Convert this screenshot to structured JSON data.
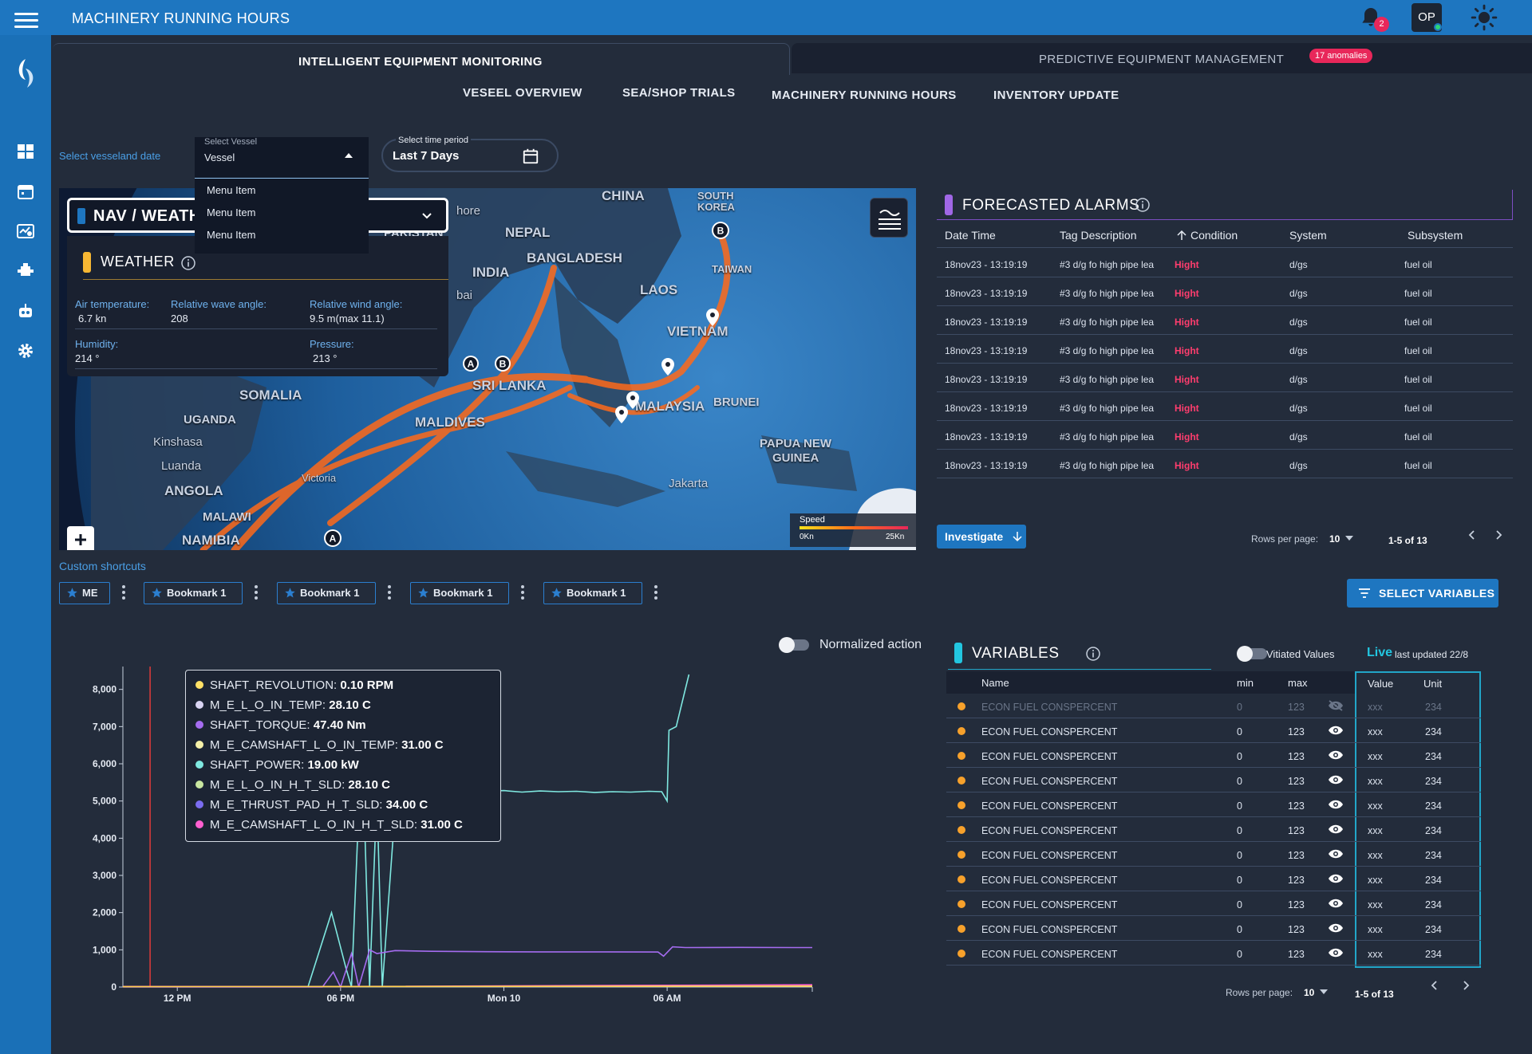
{
  "app": {
    "title": "MACHINERY RUNNING HOURS",
    "notification_count": "2",
    "user_initials": "OP"
  },
  "sidebar": {
    "items": [
      "logo-icon",
      "dashboard-icon",
      "calendar-icon",
      "analytics-icon",
      "engine-icon",
      "robot-icon",
      "settings-icon"
    ]
  },
  "tabs": {
    "active": "INTELLIGENT EQUIPMENT MONITORING",
    "other": "PREDICTIVE EQUIPMENT MANAGEMENT",
    "anomalies": "17 anomalies"
  },
  "subnav": [
    "VESEEL OVERVIEW",
    "SEA/SHOP TRIALS",
    "MACHINERY RUNNING HOURS",
    "INVENTORY UPDATE"
  ],
  "filters": {
    "section_label": "Select vesseland date",
    "vessel_label": "Select Vessel",
    "vessel_value": "Vessel",
    "menu_items": [
      "Menu Item",
      "Menu Item",
      "Menu Item"
    ],
    "time_label": "Select time period",
    "time_value": "Last 7 Days"
  },
  "map": {
    "layer_select": "NAV / WEATHER",
    "labels": {
      "china": "CHINA",
      "south_korea_1": "SOUTH",
      "south_korea_2": "KOREA",
      "nepal": "NEPAL",
      "pakistan": "PAKISTAN",
      "india": "INDIA",
      "bangladesh": "BANGLADESH",
      "taiwan": "TAIWAN",
      "laos": "LAOS",
      "vietnam": "VIETNAM",
      "sri_lanka": "SRI LANKA",
      "malaysia": "MALAYSIA",
      "brunei": "BRUNEI",
      "somalia": "SOMALIA",
      "uganda": "UGANDA",
      "maldives": "MALDIVES",
      "kinshasa": "Kinshasa",
      "luanda": "Luanda",
      "angola": "ANGOLA",
      "malawi": "MALAWI",
      "namibia": "NAMIBIA",
      "victoria": "Victoria",
      "jakarta": "Jakarta",
      "png_1": "PAPUA NEW",
      "png_2": "GUINEA",
      "hore": "hore",
      "bai": "bai"
    },
    "markers": {
      "a": "A",
      "b": "B"
    },
    "speed": {
      "title": "Speed",
      "min": "0Kn",
      "max": "25Kn"
    }
  },
  "weather": {
    "title": "WEATHER",
    "fields": [
      {
        "label": "Air temperature:",
        "value": "6.7 kn"
      },
      {
        "label": "Relative wave angle:",
        "value": "208"
      },
      {
        "label": "Relative wind angle:",
        "value": "9.5 m(max 11.1)"
      },
      {
        "label": "Humidity:",
        "value": "214 °"
      },
      {
        "label": "Pressure:",
        "value": "213 °"
      }
    ]
  },
  "alarms": {
    "title": "FORECASTED ALARMS",
    "columns": [
      "Date Time",
      "Tag Description",
      "Condition",
      "System",
      "Subsystem"
    ],
    "rows": [
      {
        "date": "18nov23 - 13:19:19",
        "tag": "#3 d/g fo high pipe lea",
        "condition": "Hight",
        "system": "d/gs",
        "subsystem": "fuel oil"
      },
      {
        "date": "18nov23 - 13:19:19",
        "tag": "#3 d/g fo high pipe lea",
        "condition": "Hight",
        "system": "d/gs",
        "subsystem": "fuel oil"
      },
      {
        "date": "18nov23 - 13:19:19",
        "tag": "#3 d/g fo high pipe lea",
        "condition": "Hight",
        "system": "d/gs",
        "subsystem": "fuel oil"
      },
      {
        "date": "18nov23 - 13:19:19",
        "tag": "#3 d/g fo high pipe lea",
        "condition": "Hight",
        "system": "d/gs",
        "subsystem": "fuel oil"
      },
      {
        "date": "18nov23 - 13:19:19",
        "tag": "#3 d/g fo high pipe lea",
        "condition": "Hight",
        "system": "d/gs",
        "subsystem": "fuel oil"
      },
      {
        "date": "18nov23 - 13:19:19",
        "tag": "#3 d/g fo high pipe lea",
        "condition": "Hight",
        "system": "d/gs",
        "subsystem": "fuel oil"
      },
      {
        "date": "18nov23 - 13:19:19",
        "tag": "#3 d/g fo high pipe lea",
        "condition": "Hight",
        "system": "d/gs",
        "subsystem": "fuel oil"
      },
      {
        "date": "18nov23 - 13:19:19",
        "tag": "#3 d/g fo high pipe lea",
        "condition": "Hight",
        "system": "d/gs",
        "subsystem": "fuel oil"
      }
    ],
    "investigate_label": "Investigate",
    "rows_per_page_label": "Rows per page:",
    "rows_per_page": "10",
    "range": "1-5 of 13"
  },
  "shortcuts": {
    "label": "Custom shortcuts",
    "items": [
      "ME",
      "Bookmark 1",
      "Bookmark 1",
      "Bookmark 1",
      "Bookmark 1"
    ],
    "select_variables_label": "SELECT VARIABLES"
  },
  "chart_controls": {
    "normalized_label": "Normalized action"
  },
  "chart_data": {
    "type": "line",
    "title": "",
    "xlabel": "",
    "ylabel": "",
    "ylim": [
      0,
      8400
    ],
    "yticks": [
      0,
      1000,
      2000,
      3000,
      4000,
      5000,
      6000,
      7000,
      8000
    ],
    "ytick_labels": [
      "0",
      "1,000",
      "2,000",
      "3,000",
      "4,000",
      "5,000",
      "6,000",
      "7,000",
      "8,000"
    ],
    "xlim": [
      0,
      38
    ],
    "xticks": [
      {
        "x": 3,
        "label": "12 PM"
      },
      {
        "x": 12,
        "label": "06 PM"
      },
      {
        "x": 21,
        "label": "Mon 10"
      },
      {
        "x": 30,
        "label": "06 AM"
      }
    ],
    "marker_x": 1.5,
    "series": [
      {
        "name": "SHAFT_POWER",
        "color": "#7fe8e0",
        "points": [
          [
            10.2,
            0
          ],
          [
            11.5,
            2000
          ],
          [
            12.3,
            500
          ],
          [
            12.6,
            0
          ],
          [
            13.1,
            6000
          ],
          [
            13.3,
            4800
          ],
          [
            13.6,
            0
          ],
          [
            14.0,
            5200
          ],
          [
            14.3,
            0
          ],
          [
            15.1,
            5400
          ],
          [
            16.0,
            5300
          ],
          [
            17.0,
            5280
          ],
          [
            18.0,
            5250
          ],
          [
            19.0,
            5300
          ],
          [
            20.0,
            5260
          ],
          [
            21.0,
            5280
          ],
          [
            22.0,
            5240
          ],
          [
            23.0,
            5270
          ],
          [
            24.0,
            5250
          ],
          [
            25.0,
            5260
          ],
          [
            26.0,
            5230
          ],
          [
            27.0,
            5250
          ],
          [
            28.0,
            5240
          ],
          [
            29.0,
            5260
          ],
          [
            29.7,
            5250
          ],
          [
            30.0,
            5000
          ],
          [
            30.1,
            6900
          ],
          [
            30.5,
            7000
          ],
          [
            31.2,
            8400
          ]
        ]
      },
      {
        "name": "SHAFT_TORQUE",
        "color": "#a56cf0",
        "points": [
          [
            0,
            0
          ],
          [
            11.0,
            0
          ],
          [
            11.6,
            400
          ],
          [
            12.0,
            0
          ],
          [
            12.6,
            900
          ],
          [
            13.0,
            0
          ],
          [
            13.6,
            1000
          ],
          [
            14.0,
            900
          ],
          [
            15.0,
            980
          ],
          [
            17.0,
            960
          ],
          [
            20.0,
            950
          ],
          [
            23.0,
            945
          ],
          [
            26.0,
            945
          ],
          [
            29.5,
            940
          ],
          [
            29.8,
            830
          ],
          [
            30.3,
            1080
          ],
          [
            31.0,
            1060
          ],
          [
            34.0,
            1065
          ],
          [
            37.0,
            1060
          ],
          [
            38.0,
            1060
          ]
        ]
      },
      {
        "name": "M_E_CAMSHAFT_L_O_IN_H_T_SLD",
        "color": "#ff5fd0",
        "points": [
          [
            0,
            15
          ],
          [
            12.0,
            15
          ],
          [
            38.0,
            60
          ]
        ]
      },
      {
        "name": "M_E_L_O_IN_TEMP",
        "color": "#ffd54a",
        "points": [
          [
            0,
            8
          ],
          [
            38.0,
            25
          ]
        ]
      }
    ]
  },
  "tooltip": {
    "rows": [
      {
        "name": "SHAFT_REVOLUTION:",
        "value": "0.10 RPM",
        "color": "#ffe066"
      },
      {
        "name": "M_E_L_O_IN_TEMP:",
        "value": "28.10 C",
        "color": "#d9d4f2"
      },
      {
        "name": "SHAFT_TORQUE:",
        "value": "47.40 Nm",
        "color": "#a56cf0"
      },
      {
        "name": "M_E_CAMSHAFT_L_O_IN_TEMP:",
        "value": "31.00 C",
        "color": "#f5f0a8"
      },
      {
        "name": "SHAFT_POWER:",
        "value": "19.00 kW",
        "color": "#7fe8e0"
      },
      {
        "name": "M_E_L_O_IN_H_T_SLD:",
        "value": "28.10 C",
        "color": "#c8e6a0"
      },
      {
        "name": "M_E_THRUST_PAD_H_T_SLD:",
        "value": "34.00 C",
        "color": "#7a6cf0"
      },
      {
        "name": "M_E_CAMSHAFT_L_O_IN_H_T_SLD:",
        "value": "31.00 C",
        "color": "#ff5fd0"
      }
    ]
  },
  "variables": {
    "title": "VARIABLES",
    "vitiated_label": "Vitiated Values",
    "live_label": "Live",
    "updated_label": "last updated 22/8",
    "columns": [
      "Name",
      "min",
      "max",
      "Value",
      "Unit"
    ],
    "rows": [
      {
        "name": "ECON FUEL CONSPERCENT",
        "min": "0",
        "max": "123",
        "value": "xxx",
        "unit": "234",
        "visible": false
      },
      {
        "name": "ECON FUEL CONSPERCENT",
        "min": "0",
        "max": "123",
        "value": "xxx",
        "unit": "234",
        "visible": true
      },
      {
        "name": "ECON FUEL CONSPERCENT",
        "min": "0",
        "max": "123",
        "value": "xxx",
        "unit": "234",
        "visible": true
      },
      {
        "name": "ECON FUEL CONSPERCENT",
        "min": "0",
        "max": "123",
        "value": "xxx",
        "unit": "234",
        "visible": true
      },
      {
        "name": "ECON FUEL CONSPERCENT",
        "min": "0",
        "max": "123",
        "value": "xxx",
        "unit": "234",
        "visible": true
      },
      {
        "name": "ECON FUEL CONSPERCENT",
        "min": "0",
        "max": "123",
        "value": "xxx",
        "unit": "234",
        "visible": true
      },
      {
        "name": "ECON FUEL CONSPERCENT",
        "min": "0",
        "max": "123",
        "value": "xxx",
        "unit": "234",
        "visible": true
      },
      {
        "name": "ECON FUEL CONSPERCENT",
        "min": "0",
        "max": "123",
        "value": "xxx",
        "unit": "234",
        "visible": true
      },
      {
        "name": "ECON FUEL CONSPERCENT",
        "min": "0",
        "max": "123",
        "value": "xxx",
        "unit": "234",
        "visible": true
      },
      {
        "name": "ECON FUEL CONSPERCENT",
        "min": "0",
        "max": "123",
        "value": "xxx",
        "unit": "234",
        "visible": true
      },
      {
        "name": "ECON FUEL CONSPERCENT",
        "min": "0",
        "max": "123",
        "value": "xxx",
        "unit": "234",
        "visible": true
      }
    ],
    "rows_per_page_label": "Rows per page:",
    "rows_per_page": "10",
    "range": "1-5 of 13"
  }
}
